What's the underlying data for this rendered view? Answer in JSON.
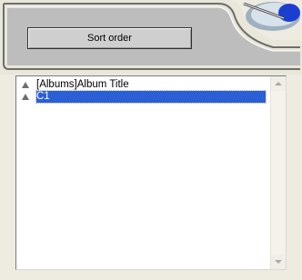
{
  "header": {
    "sort_order_label": "Sort order"
  },
  "list": {
    "items": [
      {
        "label": "[Albums]Album Title",
        "icon": "sort-ascending-icon",
        "selected": false
      },
      {
        "label": "C1",
        "icon": "sort-ascending-icon",
        "selected": true
      }
    ]
  },
  "colors": {
    "selection": "#2b5fd6",
    "panel": "#eeebe0"
  }
}
